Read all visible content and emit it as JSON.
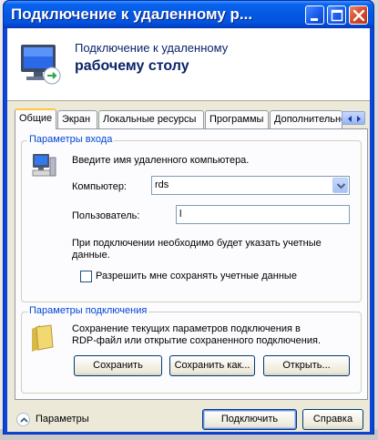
{
  "window": {
    "title": "Подключение к удаленному р..."
  },
  "header": {
    "line1": "Подключение к удаленному",
    "line2": "рабочему столу"
  },
  "tabs": [
    {
      "label": "Общие",
      "active": true
    },
    {
      "label": "Экран",
      "active": false
    },
    {
      "label": "Локальные ресурсы",
      "active": false
    },
    {
      "label": "Программы",
      "active": false
    },
    {
      "label": "Дополнительно",
      "active": false
    }
  ],
  "login_group": {
    "title": "Параметры входа",
    "prompt": "Введите имя удаленного компьютера.",
    "computer_label": "Компьютер:",
    "computer_value": "rds",
    "user_label": "Пользователь:",
    "user_value": "l",
    "note_line1": "При подключении необходимо будет указать учетные",
    "note_line2": "данные.",
    "save_creds_label": "Разрешить мне сохранять учетные данные"
  },
  "conn_group": {
    "title": "Параметры подключения",
    "desc_line1": "Сохранение текущих параметров подключения в",
    "desc_line2": "RDP-файл или открытие сохраненного подключения.",
    "save_label": "Сохранить",
    "save_as_label": "Сохранить как...",
    "open_label": "Открыть..."
  },
  "footer": {
    "options_label": "Параметры",
    "connect_label": "Подключить",
    "help_label": "Справка"
  },
  "colors": {
    "titlebar": "#0358e0",
    "group_title": "#0046d5",
    "header_text": "#0a246a",
    "active_tab_accent": "#ffc83c"
  }
}
